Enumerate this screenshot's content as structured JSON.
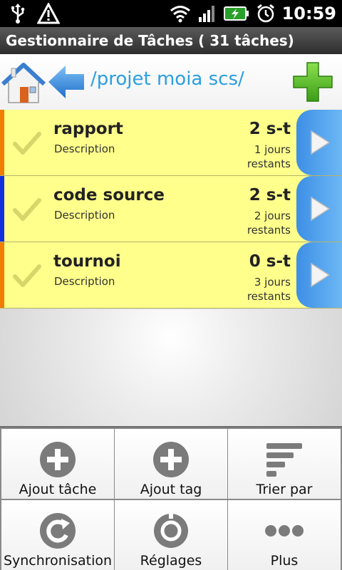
{
  "status": {
    "time": "10:59"
  },
  "title": "Gestionnaire de Tâches ( 31 tâches)",
  "toolbar": {
    "path": "/projet moia scs/"
  },
  "tasks": [
    {
      "name": "rapport",
      "description": "Description",
      "duration": "2 s-t",
      "remaining": "1 jours restants",
      "stripe_color": "#f07c00"
    },
    {
      "name": "code source",
      "description": "Description",
      "duration": "2 s-t",
      "remaining": "2 jours restants",
      "stripe_color": "#1030e0"
    },
    {
      "name": "tournoi",
      "description": "Description",
      "duration": "0 s-t",
      "remaining": "3 jours restants",
      "stripe_color": "#f07c00"
    }
  ],
  "menu": [
    {
      "label": "Ajout tâche",
      "icon": "add-circle-icon"
    },
    {
      "label": "Ajout tag",
      "icon": "add-circle-icon"
    },
    {
      "label": "Trier par",
      "icon": "sort-icon"
    },
    {
      "label": "Synchronisation",
      "icon": "sync-icon"
    },
    {
      "label": "Réglages",
      "icon": "settings-gear-icon"
    },
    {
      "label": "Plus",
      "icon": "more-dots-icon"
    }
  ],
  "colors": {
    "row_bg": "#ffff8c",
    "path_text": "#2a9fe0",
    "accent_green": "#4cb51e"
  }
}
